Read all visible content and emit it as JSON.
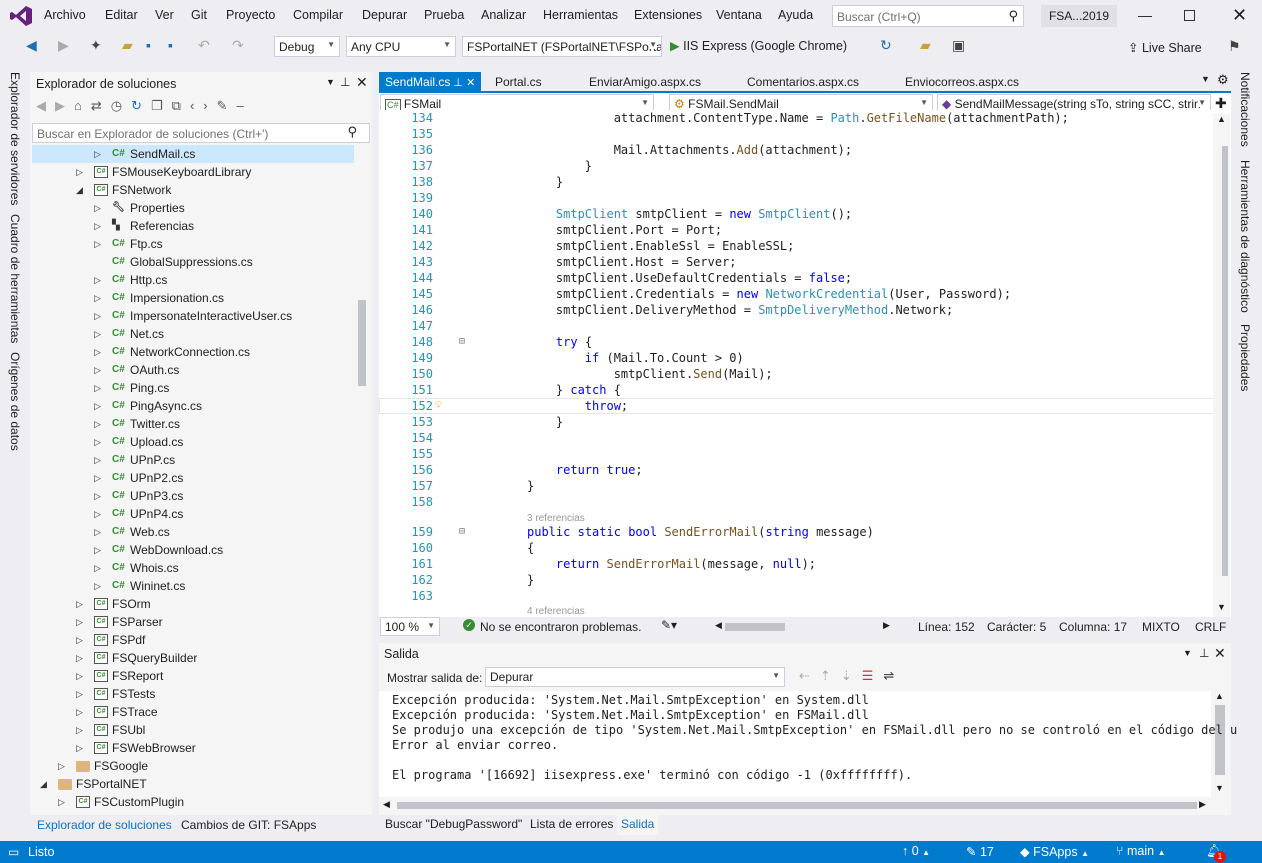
{
  "menubar": {
    "items": [
      "Archivo",
      "Editar",
      "Ver",
      "Git",
      "Proyecto",
      "Compilar",
      "Depurar",
      "Prueba",
      "Analizar",
      "Herramientas",
      "Extensiones",
      "Ventana",
      "Ayuda"
    ],
    "search_placeholder": "Buscar (Ctrl+Q)",
    "solution_badge": "FSA...2019"
  },
  "toolbar": {
    "config": "Debug",
    "platform": "Any CPU",
    "startup_project": "FSPortalNET (FSPortalNET\\FSPortal",
    "run_label": "IIS Express (Google Chrome)",
    "live_share": "Live Share"
  },
  "side_tabs": {
    "left": [
      "Explorador de servidores",
      "Cuadro de herramientas",
      "Orígenes de datos"
    ],
    "right": [
      "Notificaciones",
      "Herramientas de diagnóstico",
      "Propiedades"
    ]
  },
  "solution_explorer": {
    "title": "Explorador de soluciones",
    "search_placeholder": "Buscar en Explorador de soluciones (Ctrl+')",
    "items": [
      {
        "label": "SendMail.cs",
        "kind": "cs",
        "indent": 5,
        "expander": "right",
        "selected": true
      },
      {
        "label": "FSMouseKeyboardLibrary",
        "kind": "proj",
        "indent": 4,
        "expander": "right"
      },
      {
        "label": "FSNetwork",
        "kind": "proj",
        "indent": 4,
        "expander": "down"
      },
      {
        "label": "Properties",
        "kind": "wrench",
        "indent": 5,
        "expander": "right"
      },
      {
        "label": "Referencias",
        "kind": "refs",
        "indent": 5,
        "expander": "right"
      },
      {
        "label": "Ftp.cs",
        "kind": "cs",
        "indent": 5,
        "expander": "right"
      },
      {
        "label": "GlobalSuppressions.cs",
        "kind": "cs",
        "indent": 5,
        "expander": ""
      },
      {
        "label": "Http.cs",
        "kind": "cs",
        "indent": 5,
        "expander": "right"
      },
      {
        "label": "Impersionation.cs",
        "kind": "cs",
        "indent": 5,
        "expander": "right"
      },
      {
        "label": "ImpersonateInteractiveUser.cs",
        "kind": "cs",
        "indent": 5,
        "expander": "right"
      },
      {
        "label": "Net.cs",
        "kind": "cs",
        "indent": 5,
        "expander": "right"
      },
      {
        "label": "NetworkConnection.cs",
        "kind": "cs",
        "indent": 5,
        "expander": "right"
      },
      {
        "label": "OAuth.cs",
        "kind": "cs",
        "indent": 5,
        "expander": "right"
      },
      {
        "label": "Ping.cs",
        "kind": "cs",
        "indent": 5,
        "expander": "right"
      },
      {
        "label": "PingAsync.cs",
        "kind": "cs",
        "indent": 5,
        "expander": "right"
      },
      {
        "label": "Twitter.cs",
        "kind": "cs",
        "indent": 5,
        "expander": "right"
      },
      {
        "label": "Upload.cs",
        "kind": "cs",
        "indent": 5,
        "expander": "right"
      },
      {
        "label": "UPnP.cs",
        "kind": "cs",
        "indent": 5,
        "expander": "right"
      },
      {
        "label": "UPnP2.cs",
        "kind": "cs",
        "indent": 5,
        "expander": "right"
      },
      {
        "label": "UPnP3.cs",
        "kind": "cs",
        "indent": 5,
        "expander": "right"
      },
      {
        "label": "UPnP4.cs",
        "kind": "cs",
        "indent": 5,
        "expander": "right"
      },
      {
        "label": "Web.cs",
        "kind": "cs",
        "indent": 5,
        "expander": "right"
      },
      {
        "label": "WebDownload.cs",
        "kind": "cs",
        "indent": 5,
        "expander": "right"
      },
      {
        "label": "Whois.cs",
        "kind": "cs",
        "indent": 5,
        "expander": "right"
      },
      {
        "label": "Wininet.cs",
        "kind": "cs",
        "indent": 5,
        "expander": "right"
      },
      {
        "label": "FSOrm",
        "kind": "proj",
        "indent": 4,
        "expander": "right"
      },
      {
        "label": "FSParser",
        "kind": "proj",
        "indent": 4,
        "expander": "right"
      },
      {
        "label": "FSPdf",
        "kind": "proj",
        "indent": 4,
        "expander": "right"
      },
      {
        "label": "FSQueryBuilder",
        "kind": "proj",
        "indent": 4,
        "expander": "right"
      },
      {
        "label": "FSReport",
        "kind": "proj",
        "indent": 4,
        "expander": "right"
      },
      {
        "label": "FSTests",
        "kind": "proj",
        "indent": 4,
        "expander": "right"
      },
      {
        "label": "FSTrace",
        "kind": "proj",
        "indent": 4,
        "expander": "right"
      },
      {
        "label": "FSUbl",
        "kind": "proj",
        "indent": 4,
        "expander": "right"
      },
      {
        "label": "FSWebBrowser",
        "kind": "proj",
        "indent": 4,
        "expander": "right"
      },
      {
        "label": "FSGoogle",
        "kind": "folder",
        "indent": 3,
        "expander": "right"
      },
      {
        "label": "FSPortalNET",
        "kind": "folder",
        "indent": 2,
        "expander": "down"
      },
      {
        "label": "FSCustomPlugin",
        "kind": "proj",
        "indent": 3,
        "expander": "right"
      }
    ],
    "bottom_tabs": [
      "Explorador de soluciones",
      "Cambios de GIT: FSApps"
    ]
  },
  "editor": {
    "tabs": [
      "SendMail.cs",
      "Portal.cs",
      "EnviarAmigo.aspx.cs",
      "Comentarios.aspx.cs",
      "Enviocorreos.aspx.cs"
    ],
    "nav": {
      "project": "FSMail",
      "class": "FSMail.SendMail",
      "member": "SendMailMessage(string sTo, string sCC, strin"
    },
    "lines": [
      {
        "n": "134",
        "html": "            attachment.ContentType.Name = <span class='ty'>Path</span>.<span class='mt'>GetFileName</span>(attachmentPath);"
      },
      {
        "n": "135",
        "html": ""
      },
      {
        "n": "136",
        "html": "            Mail.Attachments.<span class='mt'>Add</span>(attachment);"
      },
      {
        "n": "137",
        "html": "        }"
      },
      {
        "n": "138",
        "html": "    }"
      },
      {
        "n": "139",
        "html": ""
      },
      {
        "n": "140",
        "html": "    <span class='ty'>SmtpClient</span> smtpClient = <span class='kw'>new</span> <span class='ty'>SmtpClient</span>();"
      },
      {
        "n": "141",
        "html": "    smtpClient.Port = Port;"
      },
      {
        "n": "142",
        "html": "    smtpClient.EnableSsl = EnableSSL;"
      },
      {
        "n": "143",
        "html": "    smtpClient.Host = Server;"
      },
      {
        "n": "144",
        "html": "    smtpClient.UseDefaultCredentials = <span class='kw'>false</span>;"
      },
      {
        "n": "145",
        "html": "    smtpClient.Credentials = <span class='kw'>new</span> <span class='ty'>NetworkCredential</span>(User, Password);"
      },
      {
        "n": "146",
        "html": "    smtpClient.DeliveryMethod = <span class='ty'>SmtpDeliveryMethod</span>.Network;"
      },
      {
        "n": "147",
        "html": ""
      },
      {
        "n": "148",
        "html": "    <span class='kw'>try</span> {"
      },
      {
        "n": "149",
        "html": "        <span class='kw'>if</span> (Mail.To.Count &gt; 0)"
      },
      {
        "n": "150",
        "html": "            smtpClient.<span class='mt'>Send</span>(Mail);"
      },
      {
        "n": "151",
        "html": "    } <span class='kw'>catch</span> {"
      },
      {
        "n": "152",
        "html": "        <span class='kw'>throw</span>;"
      },
      {
        "n": "153",
        "html": "    }"
      },
      {
        "n": "154",
        "html": ""
      },
      {
        "n": "155",
        "html": ""
      },
      {
        "n": "156",
        "html": "    <span class='kw'>return</span> <span class='kw'>true</span>;"
      },
      {
        "n": "157",
        "html": "}"
      },
      {
        "n": "158",
        "html": ""
      },
      {
        "n": "",
        "html": "<span class='cm'>3 referencias</span>"
      },
      {
        "n": "159",
        "html": "<span class='kw'>public</span> <span class='kw'>static</span> <span class='kw'>bool</span> <span class='mt'>SendErrorMail</span>(<span class='kw'>string</span> message)"
      },
      {
        "n": "160",
        "html": "{"
      },
      {
        "n": "161",
        "html": "    <span class='kw'>return</span> <span class='mt'>SendErrorMail</span>(message, <span class='kw'>null</span>);"
      },
      {
        "n": "162",
        "html": "}"
      },
      {
        "n": "163",
        "html": ""
      },
      {
        "n": "",
        "html": "<span class='cm'>4 referencias</span>"
      }
    ],
    "status": {
      "zoom": "100 %",
      "problems": "No se encontraron problemas.",
      "line": "Línea: 152",
      "char": "Carácter: 5",
      "col": "Columna: 17",
      "eol_mode": "MIXTO",
      "eol": "CRLF"
    }
  },
  "output": {
    "title": "Salida",
    "show_from_label": "Mostrar salida de:",
    "source": "Depurar",
    "lines": [
      "Excepción producida: 'System.Net.Mail.SmtpException' en System.dll",
      "Excepción producida: 'System.Net.Mail.SmtpException' en FSMail.dll",
      "Se produjo una excepción de tipo 'System.Net.Mail.SmtpException' en FSMail.dll pero no se controló en el código del u",
      "Error al enviar correo.",
      "",
      "El programa '[16692] iisexpress.exe' terminó con código -1 (0xffffffff)."
    ],
    "bottom_tabs": [
      "Buscar \"DebugPassword\"",
      "Lista de errores",
      "Salida"
    ]
  },
  "statusbar": {
    "ready": "Listo",
    "up_count": "0",
    "edits": "17",
    "repo": "FSApps",
    "branch": "main",
    "notif": "1"
  },
  "colors": {
    "accent": "#007acc",
    "selection": "#cce8ff",
    "vs_purple": "#68217a"
  }
}
